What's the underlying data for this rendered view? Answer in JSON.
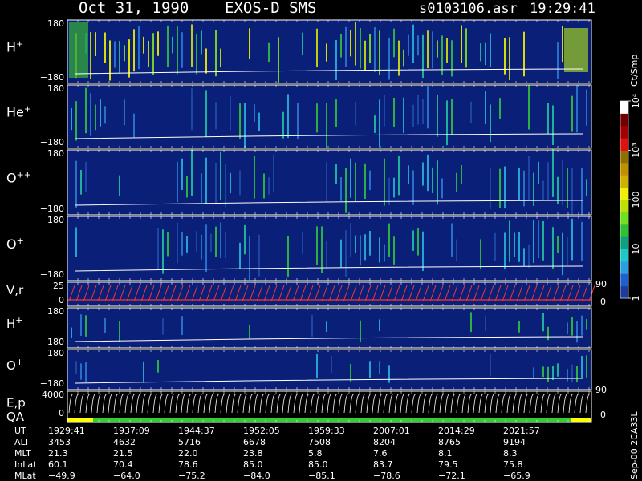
{
  "header": {
    "date": "Oct 31, 1990",
    "instrument": "EXOS-D SMS",
    "file": "s0103106.asr",
    "time": "19:29:41"
  },
  "colors": {
    "background": "#000000",
    "panel_bg": "#0a1f78",
    "frame": "#ffffff",
    "vector_red": "#ff3333",
    "qa_yellow": "#ffff00",
    "qa_green": "#33cc33"
  },
  "colorbar": {
    "unit": "Ct/Smp",
    "ticks": [
      {
        "label": "1",
        "value": 1
      },
      {
        "label": "10",
        "value": 10
      },
      {
        "label": "100",
        "value": 100
      },
      {
        "label": "10³",
        "value": 1000
      },
      {
        "label": "10⁴",
        "value": 10000
      }
    ],
    "range": [
      1,
      10000
    ],
    "scale": "log",
    "colors": [
      "#1d3c9c",
      "#2060cc",
      "#2aa0e0",
      "#20c8c8",
      "#10a080",
      "#30c030",
      "#70e020",
      "#c0e000",
      "#f0f000",
      "#d0b000",
      "#c09000",
      "#907000",
      "#e01010",
      "#a00000",
      "#700000",
      "#ffffff"
    ]
  },
  "side_labels": {
    "vr_right": "90",
    "vr_right_low": "0",
    "ep_right": "90",
    "ep_right_low": "0",
    "version": "Sep-00 2CA33L"
  },
  "chart_data": [
    {
      "type": "heatmap",
      "name": "H+",
      "label": "H",
      "superscript": "+",
      "ylim": [
        -180,
        180
      ],
      "tick_top": "180",
      "tick_bottom": "−180",
      "xlim": [
        0,
        1
      ]
    },
    {
      "type": "heatmap",
      "name": "He+",
      "label": "He",
      "superscript": "+",
      "ylim": [
        -180,
        180
      ],
      "tick_top": "180",
      "tick_bottom": "−180",
      "xlim": [
        0,
        1
      ]
    },
    {
      "type": "heatmap",
      "name": "O++",
      "label": "O",
      "superscript": "++",
      "ylim": [
        -180,
        180
      ],
      "tick_top": "180",
      "tick_bottom": "−180",
      "xlim": [
        0,
        1
      ]
    },
    {
      "type": "heatmap",
      "name": "O+",
      "label": "O",
      "superscript": "+",
      "ylim": [
        -180,
        180
      ],
      "tick_top": "180",
      "tick_bottom": "−180",
      "xlim": [
        0,
        1
      ]
    },
    {
      "type": "line",
      "name": "V,r",
      "label": "V,r",
      "ylim": [
        0,
        25
      ],
      "tick_top": "25",
      "tick_bottom": "0",
      "y2lim": [
        0,
        90
      ]
    },
    {
      "type": "heatmap",
      "name": "H+ (2)",
      "label": "H",
      "superscript": "+",
      "ylim": [
        -180,
        180
      ],
      "tick_top": "180",
      "tick_bottom": "−180"
    },
    {
      "type": "heatmap",
      "name": "O+ (2)",
      "label": "O",
      "superscript": "+",
      "ylim": [
        -180,
        180
      ],
      "tick_top": "180",
      "tick_bottom": "−180"
    },
    {
      "type": "line",
      "name": "E,p",
      "label": "E,p",
      "label2": "QA",
      "ylim": [
        0,
        4000
      ],
      "tick_top": "4000",
      "tick_bottom": "0",
      "y2lim": [
        0,
        90
      ]
    }
  ],
  "ephemeris": {
    "rows": [
      {
        "label": "UT",
        "values": [
          "1929:41",
          "1937:09",
          "1944:37",
          "1952:05",
          "1959:33",
          "2007:01",
          "2014:29",
          "2021:57"
        ]
      },
      {
        "label": "ALT",
        "values": [
          "3453",
          "4632",
          "5716",
          "6678",
          "7508",
          "8204",
          "8765",
          "9194"
        ]
      },
      {
        "label": "MLT",
        "values": [
          "21.3",
          "21.5",
          "22.0",
          "23.8",
          "5.8",
          "7.6",
          "8.1",
          "8.3"
        ]
      },
      {
        "label": "InLat",
        "values": [
          "60.1",
          "70.4",
          "78.6",
          "85.0",
          "85.0",
          "83.7",
          "79.5",
          "75.8"
        ]
      },
      {
        "label": "MLat",
        "values": [
          "−49.9",
          "−64.0",
          "−75.2",
          "−84.0",
          "−85.1",
          "−78.6",
          "−72.1",
          "−65.9"
        ]
      }
    ]
  }
}
